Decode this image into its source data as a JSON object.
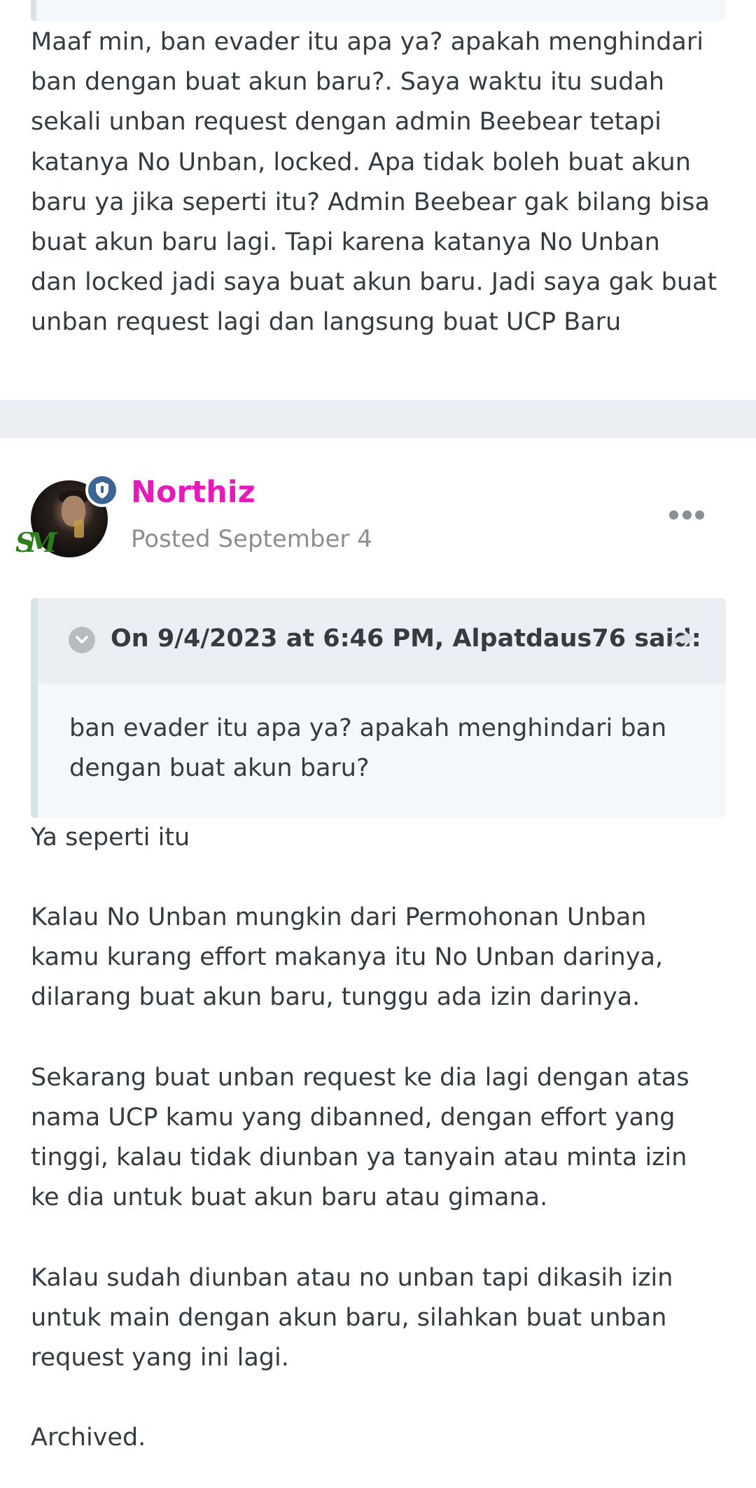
{
  "previous_post": {
    "text_lines": [
      "Maaf min, ban evader itu apa ya? apakah menghindari",
      "ban dengan buat akun baru?. Saya waktu itu sudah",
      "sekali unban request dengan admin Beebear tetapi",
      "katanya No Unban, locked. Apa tidak boleh buat akun",
      "baru ya jika seperti itu? Admin Beebear gak bilang bisa",
      "buat akun baru lagi. Tapi karena katanya No Unban",
      "dan locked jadi saya buat akun baru. Jadi saya gak buat",
      "unban request lagi dan langsung buat UCP Baru"
    ]
  },
  "post": {
    "author": "Northiz",
    "posted": "Posted September 4",
    "author_color": "#e41bb8",
    "badge_icon": "shield-icon",
    "rank_mark": "SM",
    "more_icon": "ellipsis-icon"
  },
  "quote": {
    "title": "On 9/4/2023 at 6:46 PM, Alpatdaus76 said:",
    "toggle_icon": "chevron-down-icon",
    "share_icon": "share-arrow-icon",
    "body_lines": [
      "ban evader itu apa ya? apakah menghindari ban",
      "dengan buat akun baru?"
    ]
  },
  "reply": {
    "p1": "Ya seperti itu",
    "p2_lines": [
      "Kalau No Unban mungkin dari Permohonan Unban",
      "kamu kurang effort makanya itu No Unban darinya,",
      "dilarang buat akun baru, tunggu ada izin darinya."
    ],
    "p3_lines": [
      "Sekarang buat unban request ke dia lagi dengan atas",
      "nama UCP kamu yang dibanned, dengan effort yang",
      "tinggi, kalau tidak diunban ya tanyain atau minta izin",
      "ke dia untuk buat akun baru atau gimana."
    ],
    "p4_lines": [
      "Kalau sudah diunban atau no unban tapi dikasih izin",
      "untuk main dengan akun baru, silahkan buat unban",
      "request yang ini lagi."
    ],
    "p5": "Archived."
  }
}
